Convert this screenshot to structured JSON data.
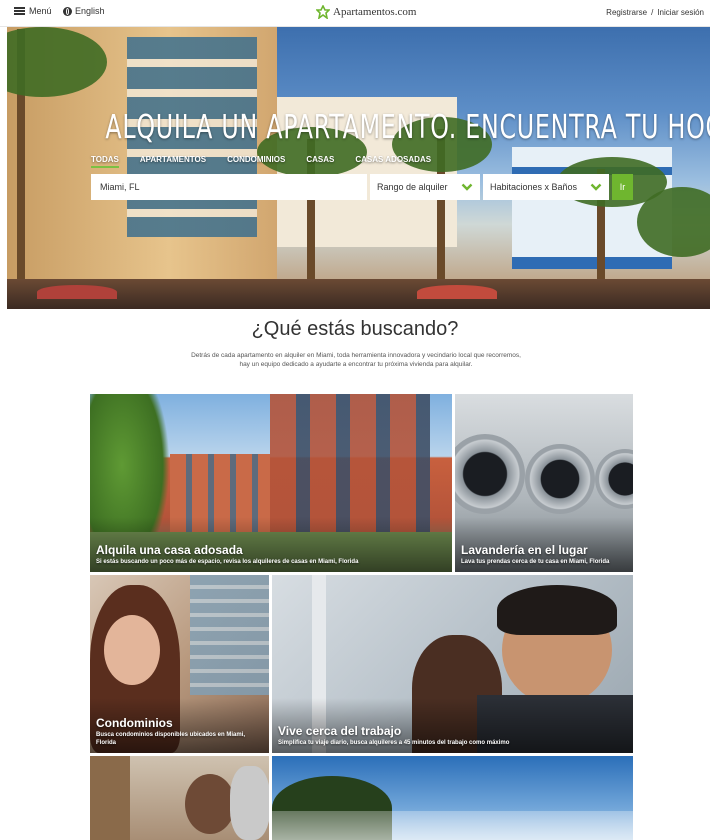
{
  "topbar": {
    "menu_label": "Menú",
    "language_label": "English",
    "logo_text": "Apartamentos.com",
    "register_label": "Registrarse",
    "separator": "/",
    "login_label": "Iniciar sesión"
  },
  "hero": {
    "title": "ALQUILA UN APARTAMENTO. ENCUENTRA TU HOGAR.",
    "tabs": [
      {
        "label": "TODAS",
        "active": true
      },
      {
        "label": "APARTAMENTOS",
        "active": false
      },
      {
        "label": "CONDOMINIOS",
        "active": false
      },
      {
        "label": "CASAS",
        "active": false
      },
      {
        "label": "CASAS ADOSADAS",
        "active": false
      }
    ],
    "search": {
      "location_value": "Miami, FL",
      "rent_range_label": "Rango de alquiler",
      "beds_baths_label": "Habitaciones x Baños",
      "go_label": "Ir"
    }
  },
  "section": {
    "heading": "¿Qué estás buscando?",
    "description": "Detrás de cada apartamento en alquiler en Miami, toda herramienta innovadora y vecindario local que recorremos, hay un equipo dedicado a ayudarte a encontrar tu próxima vivienda para alquilar."
  },
  "tiles": [
    {
      "title": "Alquila una casa adosada",
      "subtitle": "Si estás buscando un poco más de espacio, revisa los alquileres de casas en Miami, Florida"
    },
    {
      "title": "Lavandería en el lugar",
      "subtitle": "Lava tus prendas cerca de tu casa en Miami, Florida"
    },
    {
      "title": "Condominios",
      "subtitle": "Busca condominios disponibles ubicados en Miami, Florida"
    },
    {
      "title": "Vive cerca del trabajo",
      "subtitle": "Simplifica tu viaje diario, busca alquileres a 45 minutos del trabajo como máximo"
    }
  ],
  "colors": {
    "accent_green": "#6fb62f",
    "tab_underline": "#7bc143"
  }
}
